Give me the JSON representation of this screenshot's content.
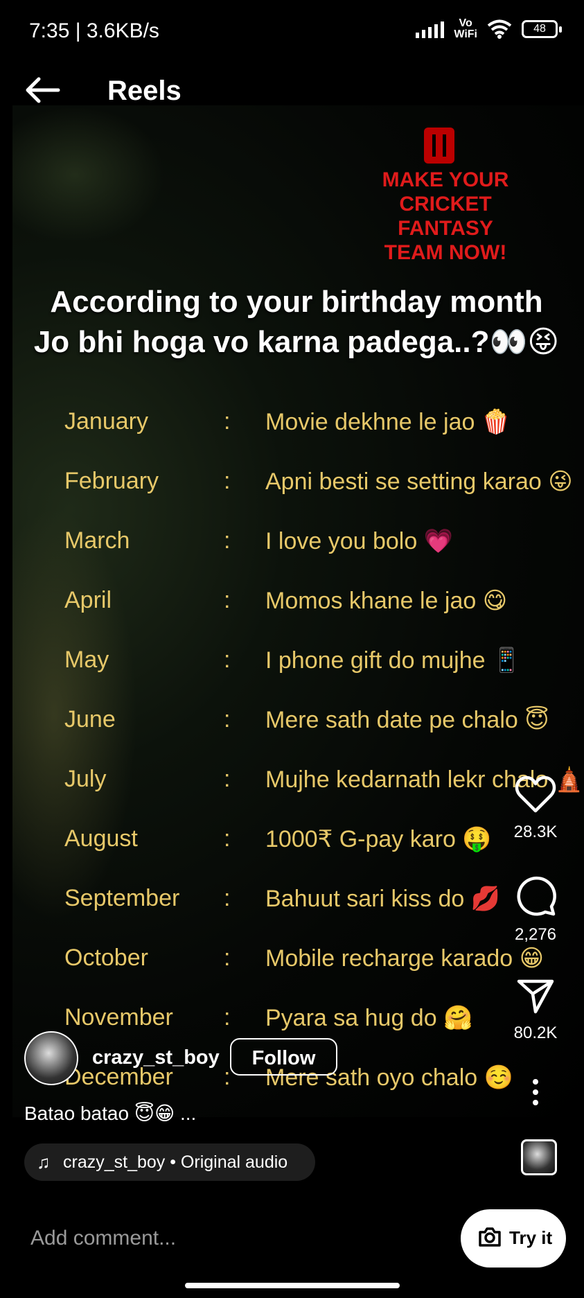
{
  "status": {
    "left": "7:35 | 3.6KB/s",
    "vowifi_top": "Vo",
    "vowifi_bottom": "WiFi",
    "battery": "48"
  },
  "header": {
    "title": "Reels"
  },
  "video": {
    "ad_lines": [
      "MAKE YOUR",
      "CRICKET",
      "FANTASY",
      "TEAM NOW!"
    ],
    "headline_1": "According to your birthday month",
    "headline_2": "Jo bhi hoga vo karna padega..?👀😝",
    "colon": ":",
    "months": [
      {
        "month": "January",
        "text": "Movie dekhne le jao 🍿"
      },
      {
        "month": "February",
        "text": "Apni besti se setting karao 😜"
      },
      {
        "month": "March",
        "text": "I love you bolo 💗"
      },
      {
        "month": "April",
        "text": "Momos khane le jao 😋"
      },
      {
        "month": "May",
        "text": "I phone gift do mujhe 📱"
      },
      {
        "month": "June",
        "text": "Mere sath date pe chalo 😇"
      },
      {
        "month": "July",
        "text": "Mujhe kedarnath lekr chalo 🛕"
      },
      {
        "month": "August",
        "text": "1000₹ G-pay karo 🤑"
      },
      {
        "month": "September",
        "text": "Bahuut sari kiss do 💋"
      },
      {
        "month": "October",
        "text": "Mobile recharge karado 😁"
      },
      {
        "month": "November",
        "text": "Pyara sa hug do 🤗"
      },
      {
        "month": "December",
        "text": "Mere sath oyo chalo ☺️"
      }
    ]
  },
  "actions": {
    "likes": "28.3K",
    "comments": "2,276",
    "shares": "80.2K"
  },
  "post": {
    "username": "crazy_st_boy",
    "follow_label": "Follow",
    "caption": "Batao batao 😇😁 ...",
    "audio": "crazy_st_boy • Original audio"
  },
  "bottom": {
    "comment_placeholder": "Add comment...",
    "try_label": "Try it"
  }
}
